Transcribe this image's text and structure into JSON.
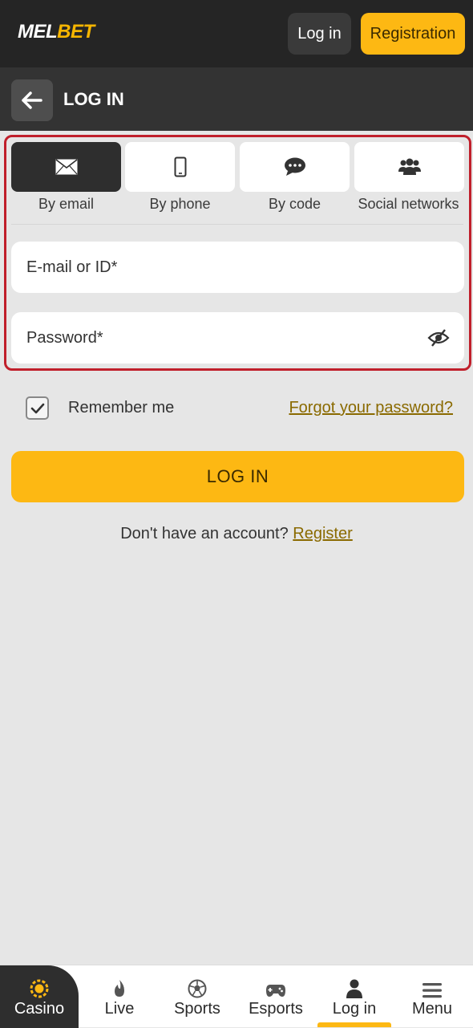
{
  "brand": {
    "logo_main": "MEL",
    "logo_accent": "BET"
  },
  "header": {
    "login_label": "Log in",
    "registration_label": "Registration"
  },
  "subheader": {
    "title": "LOG IN"
  },
  "tabs": [
    {
      "label": "By email",
      "icon": "envelope-icon",
      "active": true
    },
    {
      "label": "By phone",
      "icon": "phone-icon",
      "active": false
    },
    {
      "label": "By code",
      "icon": "chat-bubble-icon",
      "active": false
    },
    {
      "label": "Social networks",
      "icon": "users-icon",
      "active": false
    }
  ],
  "form": {
    "email_placeholder": "E-mail or ID*",
    "password_placeholder": "Password*",
    "remember_label": "Remember me",
    "remember_checked": true,
    "forgot_label": "Forgot your password?",
    "submit_label": "LOG IN",
    "no_account_text": "Don't have an account?",
    "register_link": "Register"
  },
  "bottom_nav": [
    {
      "label": "Casino",
      "icon": "casino-chip-icon"
    },
    {
      "label": "Live",
      "icon": "flame-icon"
    },
    {
      "label": "Sports",
      "icon": "soccer-ball-icon"
    },
    {
      "label": "Esports",
      "icon": "gamepad-icon"
    },
    {
      "label": "Log in",
      "icon": "person-icon",
      "active": true
    },
    {
      "label": "Menu",
      "icon": "hamburger-icon"
    }
  ],
  "colors": {
    "accent": "#fdb813",
    "dark": "#252525",
    "highlight_border": "#c01f2b",
    "link": "#8a6a00"
  }
}
